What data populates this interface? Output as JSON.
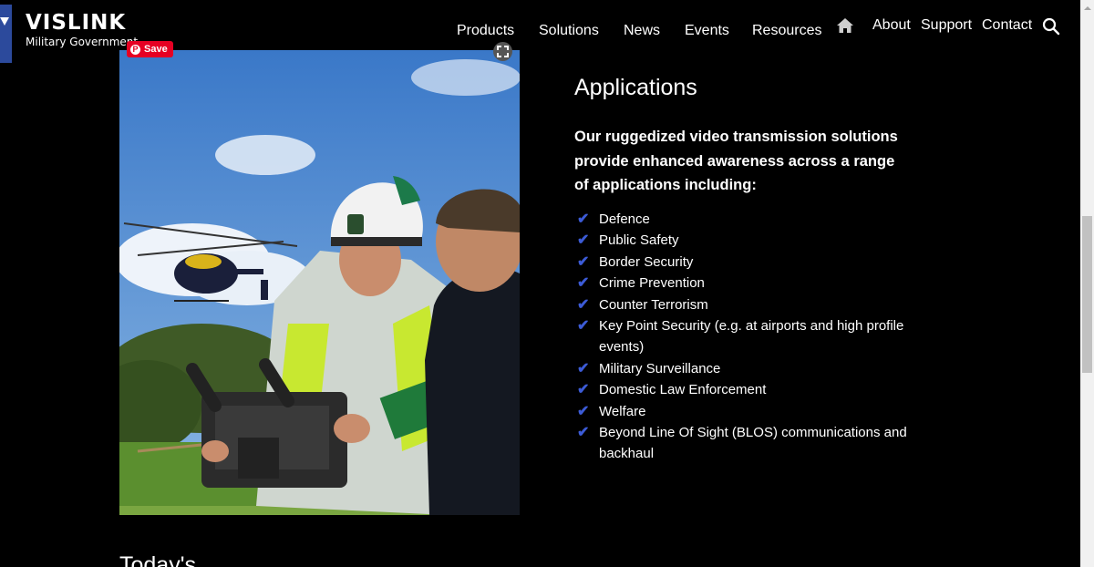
{
  "brand": {
    "name": "VISLINK",
    "tagline": "Military Government"
  },
  "nav": {
    "main": [
      "Products",
      "Solutions",
      "News",
      "Events",
      "Resources"
    ],
    "secondary": [
      "About",
      "Support",
      "Contact"
    ],
    "home_icon": "home-icon",
    "search_icon": "search-icon"
  },
  "image": {
    "save_label": "Save",
    "pin_icon": "pinterest-icon",
    "expand_icon": "expand-icon"
  },
  "applications": {
    "title": "Applications",
    "intro": "Our ruggedized video transmission solutions provide enhanced awareness across a range of applications including:",
    "items": [
      "Defence",
      "Public Safety",
      "Border Security",
      "Crime Prevention",
      "Counter Terrorism",
      "Key Point Security (e.g. at airports and high profile events)",
      "Military Surveillance",
      "Domestic Law Enforcement",
      "Welfare",
      "Beyond Line Of Sight (BLOS) communications and backhaul"
    ],
    "check_icon": "check-icon",
    "check_color": "#3c5bd6"
  },
  "next_section_heading": "Today's",
  "colors": {
    "background": "#000000",
    "brand_blue": "#2c4a9c",
    "pinterest_red": "#e60023"
  }
}
